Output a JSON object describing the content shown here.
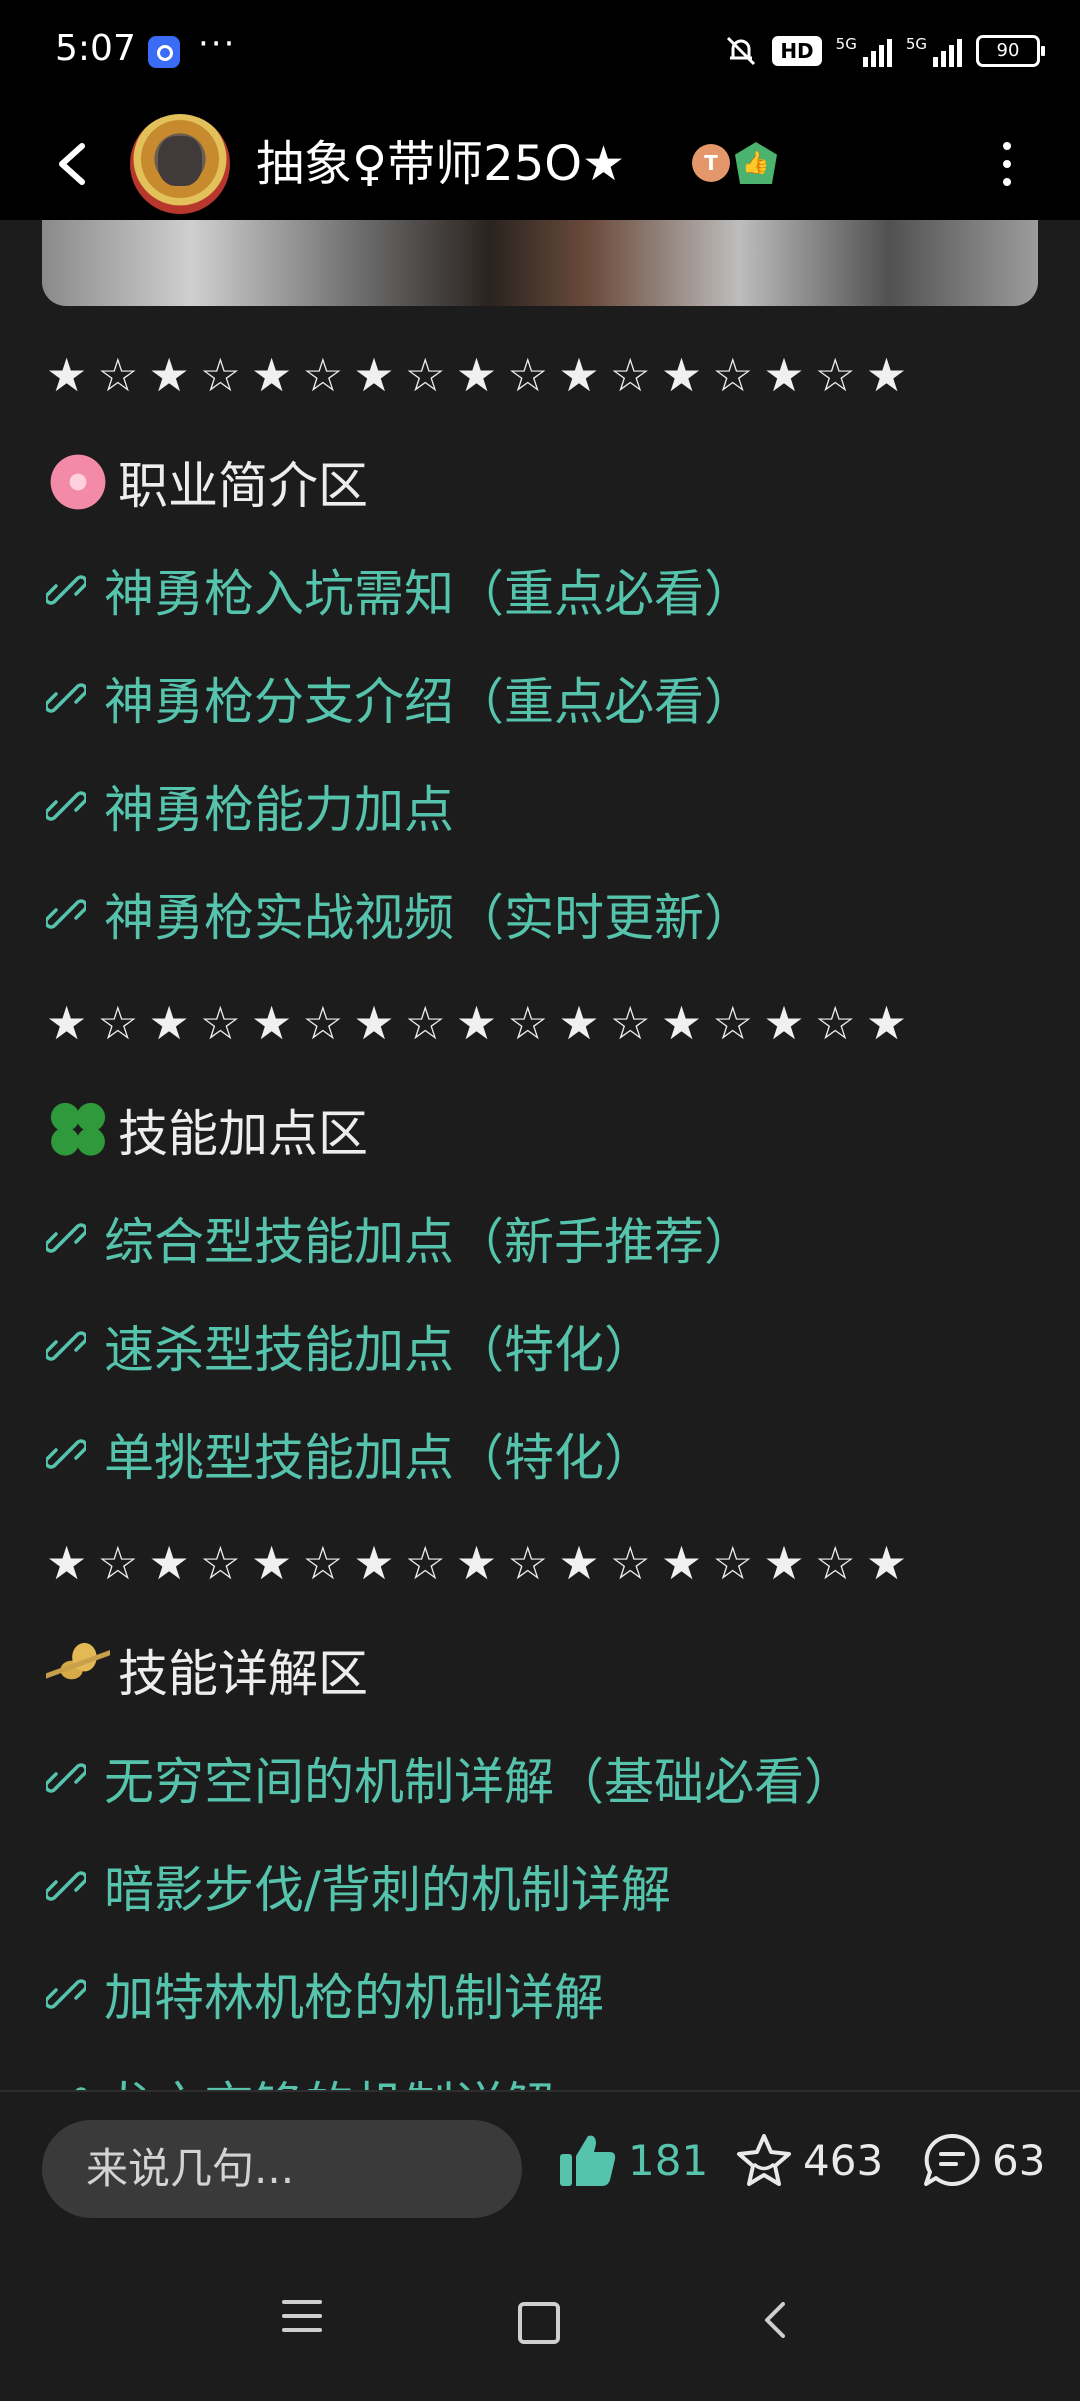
{
  "status_bar": {
    "time": "5:07",
    "dots": "···",
    "hd": "HD",
    "net1": "5G",
    "net2": "5G",
    "battery": "90"
  },
  "header": {
    "title": "抽象♀带师25O★",
    "badge1": "T",
    "badge2": "👍"
  },
  "content": {
    "stars_line": "★☆★☆★☆★☆★☆★☆★☆★☆★",
    "sections": [
      {
        "title": "职业简介区",
        "icon": "cherry-blossom-icon",
        "links": [
          "神勇枪入坑需知（重点必看）",
          "神勇枪分支介绍（重点必看）",
          "神勇枪能力加点",
          "神勇枪实战视频（实时更新）"
        ]
      },
      {
        "title": "技能加点区",
        "icon": "four-leaf-clover-icon",
        "links": [
          "综合型技能加点（新手推荐）",
          "速杀型技能加点（特化）",
          "单挑型技能加点（特化）"
        ]
      },
      {
        "title": "技能详解区",
        "icon": "wheat-icon",
        "links": [
          "无穷空间的机制详解（基础必看）",
          "暗影步伐/背刺的机制详解",
          "加特林机枪的机制详解",
          "龙之交锋的机制详解"
        ]
      }
    ]
  },
  "bottom_bar": {
    "comment_placeholder": "来说几句...",
    "likes": "181",
    "favorites": "463",
    "comments": "63"
  },
  "colors": {
    "link": "#56c3ac",
    "background": "#1c1c1c",
    "header": "#000000"
  }
}
